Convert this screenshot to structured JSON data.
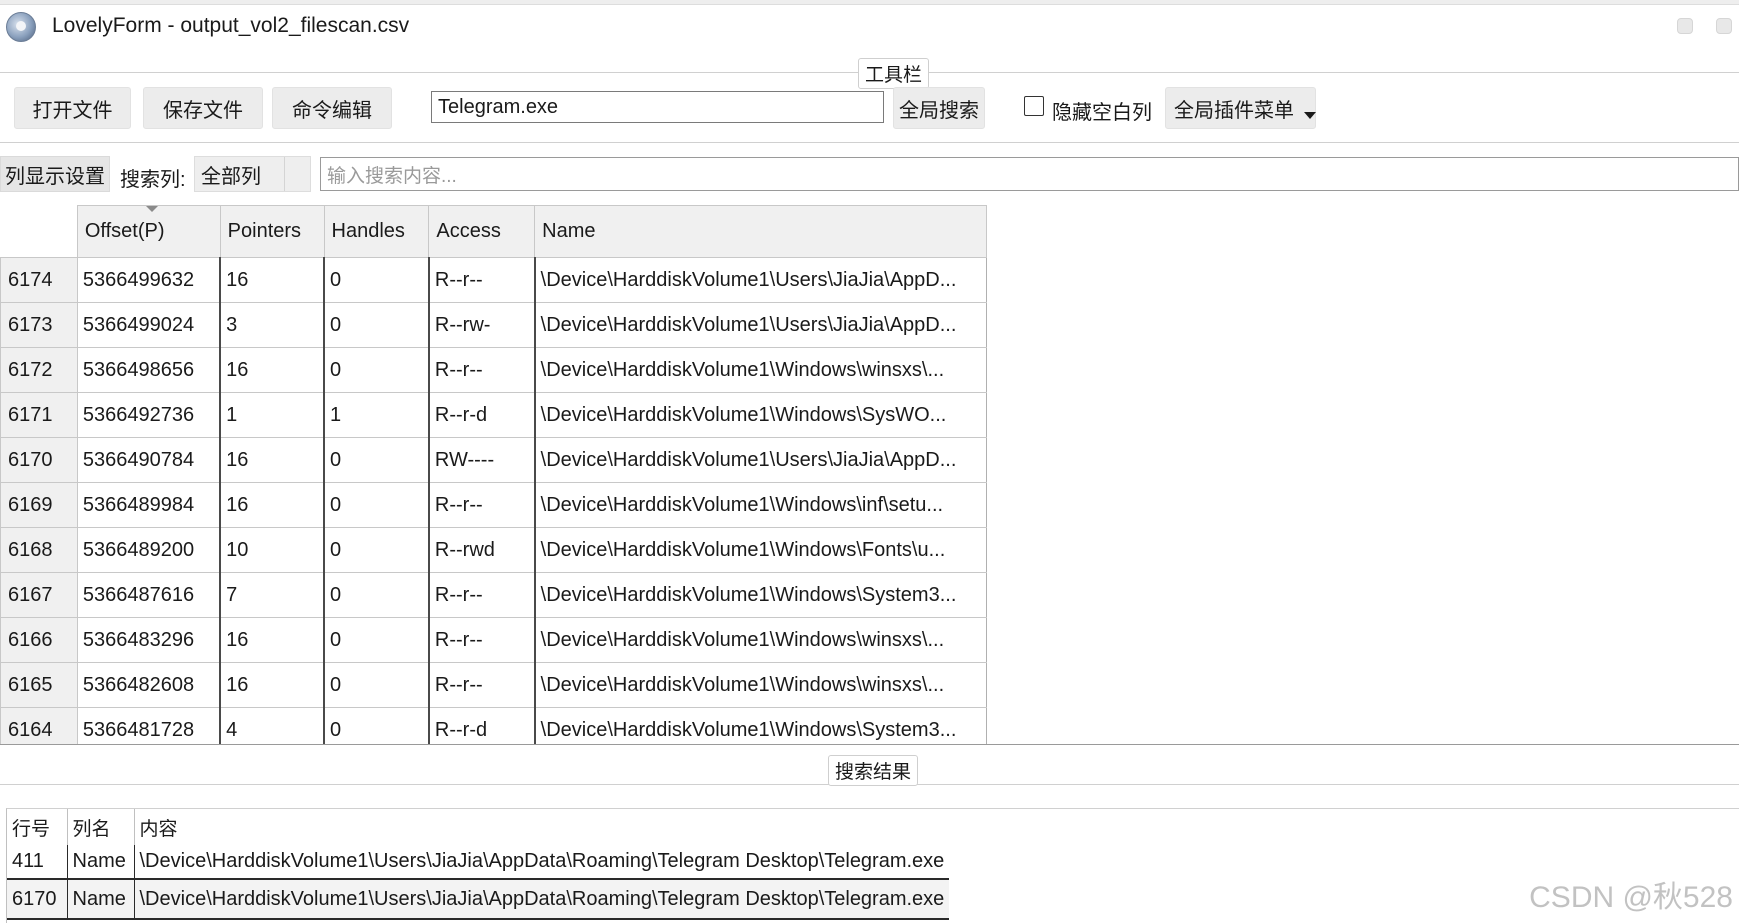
{
  "window": {
    "title": "LovelyForm - output_vol2_filescan.csv"
  },
  "toolbar": {
    "group_label": "工具栏",
    "open_file": "打开文件",
    "save_file": "保存文件",
    "command_edit": "命令编辑",
    "search_value": "Telegram.exe",
    "global_search": "全局搜索",
    "hide_empty_cols": "隐藏空白列",
    "hide_empty_checked": false,
    "plugin_menu": "全局插件菜单"
  },
  "filter": {
    "column_settings": "列显示设置",
    "search_col_label": "搜索列:",
    "search_col_value": "全部列",
    "search_placeholder": "输入搜索内容..."
  },
  "grid": {
    "headers": [
      "Offset(P)",
      "Pointers",
      "Handles",
      "Access",
      "Name"
    ],
    "rows": [
      {
        "id": "6174",
        "cells": [
          "5366499632",
          "16",
          "0",
          "R--r--",
          "\\Device\\HarddiskVolume1\\Users\\JiaJia\\AppD..."
        ]
      },
      {
        "id": "6173",
        "cells": [
          "5366499024",
          "3",
          "0",
          "R--rw-",
          "\\Device\\HarddiskVolume1\\Users\\JiaJia\\AppD..."
        ]
      },
      {
        "id": "6172",
        "cells": [
          "5366498656",
          "16",
          "0",
          "R--r--",
          "\\Device\\HarddiskVolume1\\Windows\\winsxs\\..."
        ]
      },
      {
        "id": "6171",
        "cells": [
          "5366492736",
          "1",
          "1",
          "R--r-d",
          "\\Device\\HarddiskVolume1\\Windows\\SysWO..."
        ]
      },
      {
        "id": "6170",
        "cells": [
          "5366490784",
          "16",
          "0",
          "RW----",
          "\\Device\\HarddiskVolume1\\Users\\JiaJia\\AppD..."
        ]
      },
      {
        "id": "6169",
        "cells": [
          "5366489984",
          "16",
          "0",
          "R--r--",
          "\\Device\\HarddiskVolume1\\Windows\\inf\\setu..."
        ]
      },
      {
        "id": "6168",
        "cells": [
          "5366489200",
          "10",
          "0",
          "R--rwd",
          "\\Device\\HarddiskVolume1\\Windows\\Fonts\\u..."
        ]
      },
      {
        "id": "6167",
        "cells": [
          "5366487616",
          "7",
          "0",
          "R--r--",
          "\\Device\\HarddiskVolume1\\Windows\\System3..."
        ]
      },
      {
        "id": "6166",
        "cells": [
          "5366483296",
          "16",
          "0",
          "R--r--",
          "\\Device\\HarddiskVolume1\\Windows\\winsxs\\..."
        ]
      },
      {
        "id": "6165",
        "cells": [
          "5366482608",
          "16",
          "0",
          "R--r--",
          "\\Device\\HarddiskVolume1\\Windows\\winsxs\\..."
        ]
      },
      {
        "id": "6164",
        "cells": [
          "5366481728",
          "4",
          "0",
          "R--r-d",
          "\\Device\\HarddiskVolume1\\Windows\\System3..."
        ]
      }
    ]
  },
  "results": {
    "group_label": "搜索结果",
    "headers": [
      "行号",
      "列名",
      "内容"
    ],
    "rows": [
      {
        "line": "411",
        "column": "Name",
        "content": "\\Device\\HarddiskVolume1\\Users\\JiaJia\\AppData\\Roaming\\Telegram Desktop\\Telegram.exe"
      },
      {
        "line": "6170",
        "column": "Name",
        "content": "\\Device\\HarddiskVolume1\\Users\\JiaJia\\AppData\\Roaming\\Telegram Desktop\\Telegram.exe"
      }
    ],
    "selected_index": 1
  },
  "watermark": "CSDN @秋528"
}
